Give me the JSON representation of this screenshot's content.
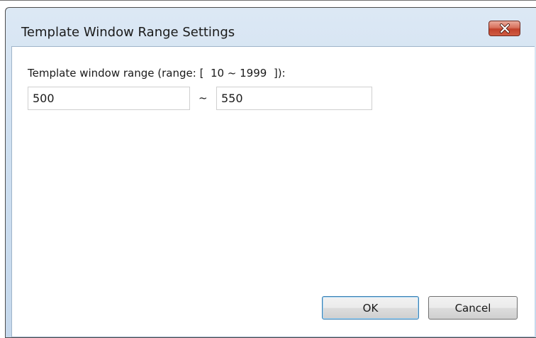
{
  "window": {
    "title": "Template Window Range Settings"
  },
  "icons": {
    "close": "close-x-icon"
  },
  "range": {
    "label": "Template window range (range: [  10 ~ 1999  ]):",
    "min_value": "500",
    "separator": "~",
    "max_value": "550"
  },
  "buttons": {
    "ok_label": "OK",
    "cancel_label": "Cancel"
  },
  "colors": {
    "close_button": "#c7503a",
    "titlebar": "#d4e3f2",
    "default_button_border": "#3c7fb1"
  }
}
